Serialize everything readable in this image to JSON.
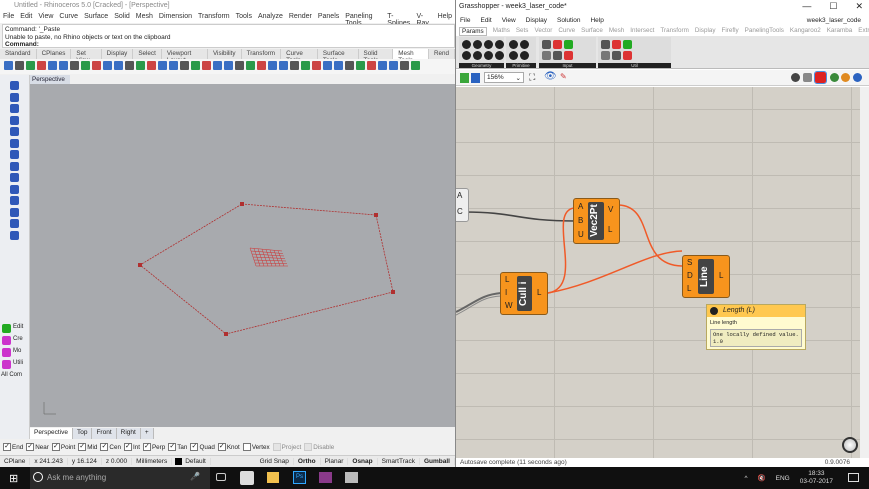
{
  "rhino": {
    "title": "Untitled - Rhinoceros 5.0 [Cracked] - [Perspective]",
    "menu": [
      "File",
      "Edit",
      "View",
      "Curve",
      "Surface",
      "Solid",
      "Mesh",
      "Dimension",
      "Transform",
      "Tools",
      "Analyze",
      "Render",
      "Panels",
      "Paneling Tools",
      "T-Splines",
      "V-Ray",
      "Help"
    ],
    "command_history": [
      "Command: '_Paste",
      "Unable to paste, no Rhino objects or text on the clipboard"
    ],
    "command_prompt": "Command:",
    "toolbar_tabs": [
      "Standard",
      "CPlanes",
      "Set View",
      "Display",
      "Select",
      "Viewport Layout",
      "Visibility",
      "Transform",
      "Curve Tools",
      "Surface Tools",
      "Solid Tools",
      "Mesh Tools",
      "Rend"
    ],
    "active_toolbar_tab": "Mesh Tools",
    "viewport_label": "Perspective",
    "side_commands": [
      "Edit",
      "Cre",
      "Mo",
      "Utili",
      "All Com"
    ],
    "viewport_tabs": [
      "Perspective",
      "Top",
      "Front",
      "Right",
      "+"
    ],
    "osnaps": [
      {
        "label": "End",
        "checked": true
      },
      {
        "label": "Near",
        "checked": true
      },
      {
        "label": "Point",
        "checked": true
      },
      {
        "label": "Mid",
        "checked": true
      },
      {
        "label": "Cen",
        "checked": true
      },
      {
        "label": "Int",
        "checked": true
      },
      {
        "label": "Perp",
        "checked": true
      },
      {
        "label": "Tan",
        "checked": true
      },
      {
        "label": "Quad",
        "checked": true
      },
      {
        "label": "Knot",
        "checked": true
      },
      {
        "label": "Vertex",
        "checked": false
      },
      {
        "label": "Project",
        "checked": false,
        "disabled": true
      },
      {
        "label": "Disable",
        "checked": false,
        "disabled": true
      }
    ],
    "status": {
      "cplane": "CPlane",
      "x": "x 241.243",
      "y": "y 16.124",
      "z": "z 0.000",
      "units": "Millimeters",
      "layer": "Default",
      "toggles": [
        {
          "label": "Grid Snap",
          "on": false
        },
        {
          "label": "Ortho",
          "on": true
        },
        {
          "label": "Planar",
          "on": false
        },
        {
          "label": "Osnap",
          "on": true
        },
        {
          "label": "SmartTrack",
          "on": false
        },
        {
          "label": "Gumball",
          "on": true
        }
      ]
    },
    "curve_color": "#c0392b"
  },
  "grasshopper": {
    "title": "Grasshopper - week3_laser_code*",
    "window_buttons": [
      "—",
      "☐",
      "✕"
    ],
    "menu": [
      "File",
      "Edit",
      "View",
      "Display",
      "Solution",
      "Help"
    ],
    "doc_name": "week3_laser_code",
    "tabs": [
      "Params",
      "Maths",
      "Sets",
      "Vector",
      "Curve",
      "Surface",
      "Mesh",
      "Intersect",
      "Transform",
      "Display",
      "Firefly",
      "PanelingTools",
      "Kangaroo2",
      "Karamba",
      "Extra"
    ],
    "active_tab": "Params",
    "ribbon_groups": [
      "Geometry",
      "Primitive",
      "Input",
      "Util"
    ],
    "zoom": "156%",
    "components": [
      {
        "name": "Vec2Pt",
        "inputs": [
          "A",
          "B",
          "U"
        ],
        "outputs": [
          "V",
          "L"
        ]
      },
      {
        "name": "Cull i",
        "inputs": [
          "L",
          "I",
          "W"
        ],
        "outputs": [
          "L"
        ]
      },
      {
        "name": "Line",
        "inputs": [
          "S",
          "D",
          "L"
        ],
        "outputs": [
          "L"
        ]
      }
    ],
    "partial_component_outputs": [
      "A",
      "C"
    ],
    "tooltip": {
      "title": "Length (L)",
      "description": "Line length",
      "value_line1": "One locally defined value.",
      "value_line2": "1.0"
    },
    "status": "Autosave complete (11 seconds ago)",
    "version": "0.9.0076",
    "wire_color": "#f05a28",
    "component_color": "#f7941d"
  },
  "taskbar": {
    "search_placeholder": "Ask me anything",
    "language": "ENG",
    "time": "18:33",
    "date": "03-07-2017"
  }
}
